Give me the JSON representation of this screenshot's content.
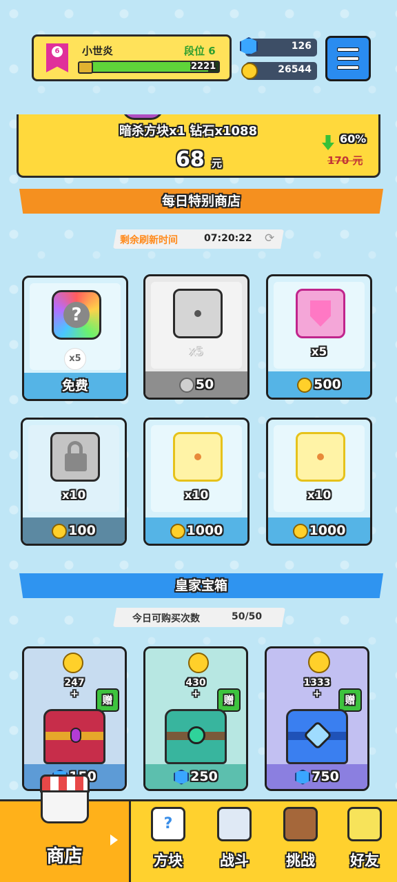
{
  "header": {
    "player_name": "小世炎",
    "rank_badge_number": "6",
    "rank_label": "段位 6",
    "xp_value": "2221",
    "xp_fill_fraction": 0.92,
    "gems": "126",
    "coins": "26544"
  },
  "offer": {
    "items_text": "暗杀方块x1   钻石x1088",
    "price": "68",
    "price_unit": "元",
    "discount": "60%",
    "old_price": "170 元"
  },
  "daily_shop": {
    "title": "每日特别商店",
    "refresh_label": "剩余刷新时间",
    "refresh_time": "07:20:22",
    "items": [
      {
        "qty": "x5",
        "price": "免费",
        "currency": "free",
        "icon_name": "mystery-dice-icon"
      },
      {
        "qty": "x5",
        "price": "50",
        "currency": "silver",
        "icon_name": "spike-dice-icon"
      },
      {
        "qty": "x5",
        "price": "500",
        "currency": "coin",
        "icon_name": "shield-dice-icon"
      },
      {
        "qty": "x10",
        "price": "100",
        "currency": "coin",
        "icon_name": "lock-dice-icon"
      },
      {
        "qty": "x10",
        "price": "1000",
        "currency": "coin",
        "icon_name": "growth-dice-icon"
      },
      {
        "qty": "x10",
        "price": "1000",
        "currency": "coin",
        "icon_name": "growth-dice-icon"
      }
    ]
  },
  "royal_chest": {
    "title": "皇家宝箱",
    "purchase_label": "今日可购买次数",
    "purchase_count": "50/50",
    "gift_label": "赠",
    "plus": "+",
    "chests": [
      {
        "coins": "247",
        "price": "150",
        "color": "#c7dcf0",
        "footer": "#5d9bd6"
      },
      {
        "coins": "430",
        "price": "250",
        "color": "#b7e7e2",
        "footer": "#5cbfae"
      },
      {
        "coins": "1333",
        "price": "750",
        "color": "#c2c0f2",
        "footer": "#8b7fe0"
      }
    ]
  },
  "nav": {
    "shop": "商店",
    "dice": "方块",
    "battle": "战斗",
    "challenge": "挑战",
    "friends": "好友"
  },
  "colors": {
    "orange_bar": "#f5901f",
    "blue_bar": "#2f94f0"
  }
}
